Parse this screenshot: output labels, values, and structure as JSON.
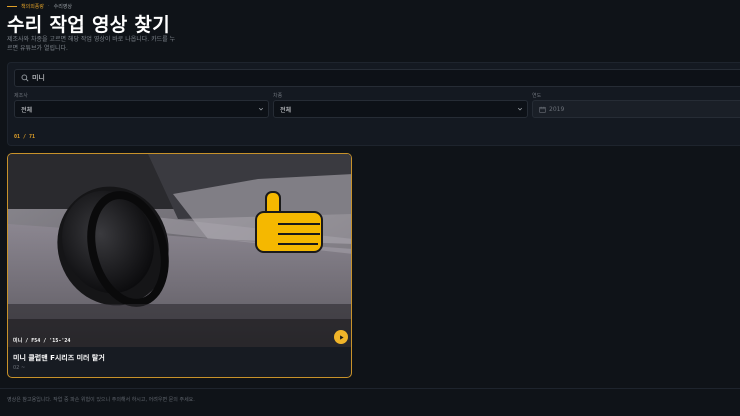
{
  "breadcrumb": {
    "items": [
      "책의외풍랑",
      "수리영상"
    ],
    "separator": "·"
  },
  "page": {
    "title": "수리 작업 영상 찾기",
    "subtitle": "제조사와 차종을 고르면 해당 작업 영상이 바로 나옵니다. 카드를 누르면 유튜브가 열립니다."
  },
  "search": {
    "value": "미니",
    "placeholder": "",
    "icon": "search-icon"
  },
  "filters": [
    {
      "label": "제조사",
      "value": "전체"
    },
    {
      "label": "차종",
      "value": "전체"
    },
    {
      "label": "연도",
      "value": "2019"
    }
  ],
  "result_count": "01 / 71",
  "cards": [
    {
      "meta": "미니 / F54 / '15-'24",
      "title": "미니 클럽맨 F시리즈 미러 탈거",
      "subtitle": "02 ~"
    }
  ],
  "footer": {
    "text": "영상은 참고용입니다. 작업 중 파손 위험이 있으니 주의해서 하시고, 어려우면 문의 주세요."
  },
  "colors": {
    "accent": "#e0a028",
    "background": "#0f1318",
    "panel": "#141921"
  }
}
